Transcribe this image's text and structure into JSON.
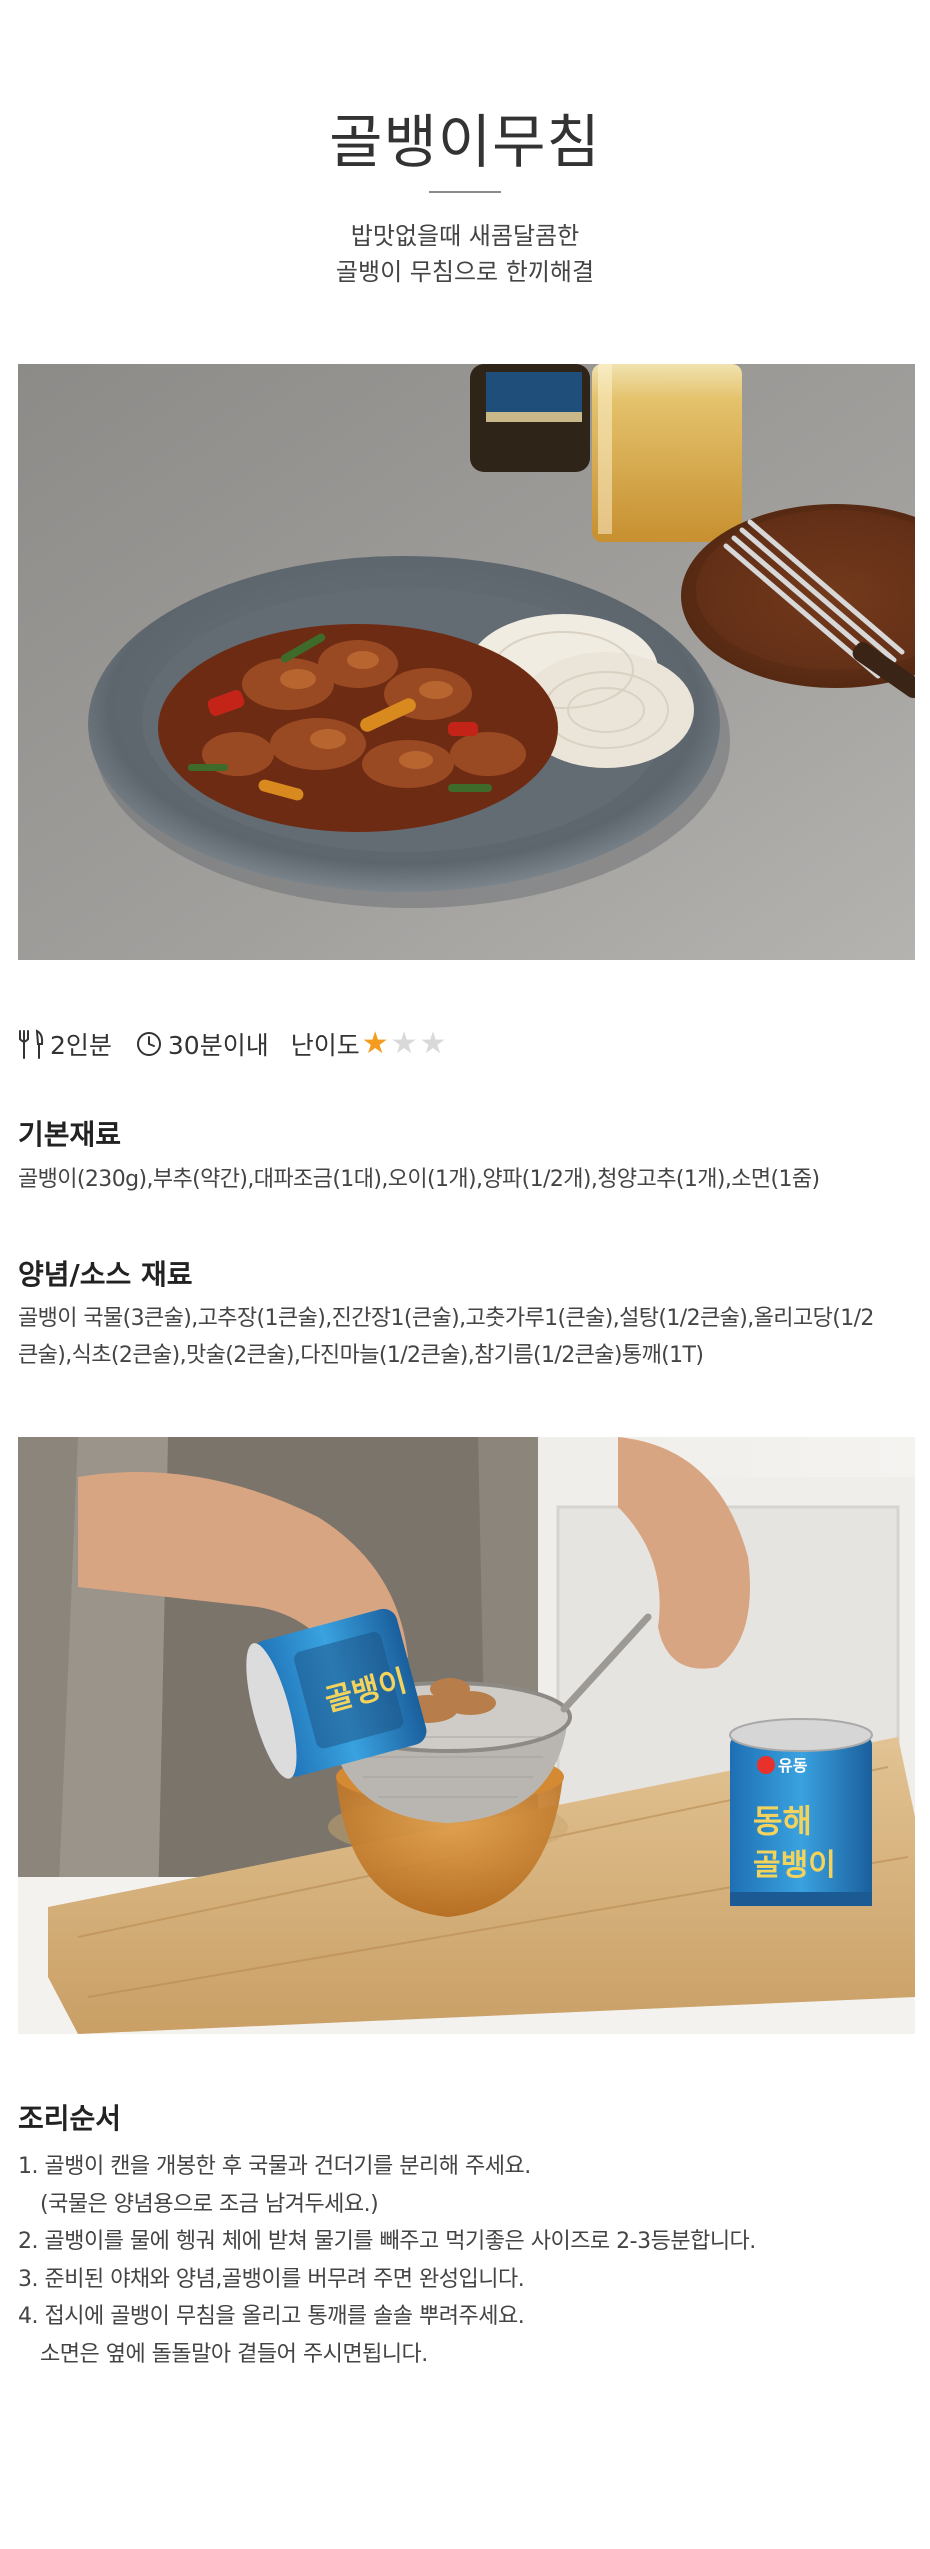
{
  "title": "골뱅이무침",
  "subtitle": {
    "line1": "밥맛없을때 새콤달콤한",
    "line2": "골뱅이 무침으로 한끼해결"
  },
  "info": {
    "servings": "2인분",
    "time": "30분이내",
    "difficulty_label": "난이도",
    "difficulty_rating": 1,
    "difficulty_max": 3
  },
  "ingredients": {
    "heading": "기본재료",
    "text": "골뱅이(230g),부추(약간),대파조금(1대),오이(1개),양파(1/2개),청양고추(1개),소면(1줌)"
  },
  "sauce": {
    "heading": "양념/소스 재료",
    "line1": "골뱅이 국물(3큰술),고추장(1큰술),진간장1(큰술),고춧가루1(큰술),설탕(1/2큰술),올리고당(1/2",
    "line2": "큰술),식초(2큰술),맛술(2큰술),다진마늘(1/2큰술),참기름(1/2큰술)통깨(1T)"
  },
  "can_label": {
    "brand": "유동",
    "name": "골뱅이",
    "tag": "동해"
  },
  "steps": {
    "heading": "조리순서",
    "s1": "1. 골뱅이 캔을 개봉한 후 국물과 건더기를 분리해 주세요.",
    "s1b": "(국물은 양념용으로 조금 남겨두세요.)",
    "s2": "2. 골뱅이를 물에 헹궈 체에 받쳐 물기를 빼주고 먹기좋은 사이즈로 2-3등분합니다.",
    "s3": "3. 준비된 야채와 양념,골뱅이를 버무려 주면 완성입니다.",
    "s4": "4. 접시에 골뱅이 무침을 올리고 통깨를 솔솔 뿌려주세요.",
    "s4b": "소면은 옆에 돌돌말아 곁들어 주시면됩니다."
  },
  "colors": {
    "star_on": "#f39c1f",
    "star_off": "#d9d9d9",
    "text": "#444444"
  }
}
